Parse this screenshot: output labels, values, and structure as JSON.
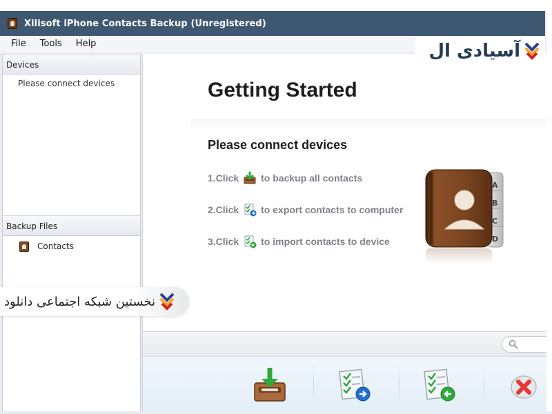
{
  "window": {
    "title": "Xilisoft iPhone Contacts Backup (Unregistered)"
  },
  "menu": {
    "items": [
      "File",
      "Tools",
      "Help"
    ]
  },
  "sidebar": {
    "devices_header": "Devices",
    "devices_placeholder": "Please connect devices",
    "backup_header": "Backup Files",
    "backup_items": [
      "Contacts"
    ]
  },
  "main": {
    "title": "Getting Started",
    "subtitle": "Please connect devices",
    "steps": [
      {
        "prefix": "1.Click",
        "suffix": "to backup all contacts",
        "icon": "backup-icon"
      },
      {
        "prefix": "2.Click",
        "suffix": "to export contacts to computer",
        "icon": "export-icon"
      },
      {
        "prefix": "3.Click",
        "suffix": "to import contacts to device",
        "icon": "import-icon"
      }
    ],
    "addressbook_tabs": [
      "A",
      "B",
      "C",
      "D"
    ]
  },
  "search": {
    "placeholder": ""
  },
  "toolbar": {
    "buttons": [
      "backup-button",
      "export-button",
      "import-button",
      "delete-button"
    ]
  },
  "watermark": {
    "logo_text": "آسیادی ال",
    "pill_text": "نخستین شبکه اجتماعی دانلود"
  },
  "colors": {
    "titlebar": "#3f5871",
    "accent_blue": "#1e6fd0",
    "accent_green": "#2fa83a",
    "delete_red": "#e2393a",
    "book_brown": "#6e3f1d"
  }
}
